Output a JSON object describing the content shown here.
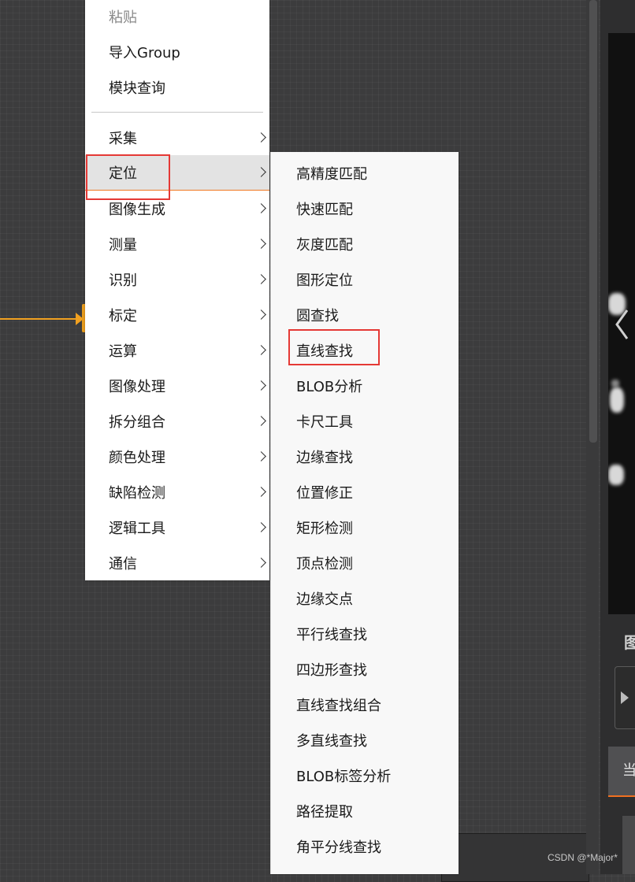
{
  "context_menu": {
    "items_top": [
      {
        "label": "粘贴",
        "disabled": true
      },
      {
        "label": "导入Group"
      },
      {
        "label": "模块查询"
      }
    ],
    "items": [
      {
        "label": "采集"
      },
      {
        "label": "定位",
        "active": true
      },
      {
        "label": "图像生成"
      },
      {
        "label": "测量"
      },
      {
        "label": "识别"
      },
      {
        "label": "标定"
      },
      {
        "label": "运算"
      },
      {
        "label": "图像处理"
      },
      {
        "label": "拆分组合"
      },
      {
        "label": "颜色处理"
      },
      {
        "label": "缺陷检测"
      },
      {
        "label": "逻辑工具"
      },
      {
        "label": "通信"
      }
    ]
  },
  "submenu": {
    "parent": "定位",
    "items": [
      "高精度匹配",
      "快速匹配",
      "灰度匹配",
      "图形定位",
      "圆查找",
      "直线查找",
      "BLOB分析",
      "卡尺工具",
      "边缘查找",
      "位置修正",
      "矩形检测",
      "顶点检测",
      "边缘交点",
      "平行线查找",
      "四边形查找",
      "直线查找组合",
      "多直线查找",
      "BLOB标签分析",
      "路径提取",
      "角平分线查找"
    ],
    "highlighted": "直线查找"
  },
  "right_panel": {
    "label_1": "图",
    "tab_label": "当"
  },
  "watermark": "CSDN @*Major*",
  "colors": {
    "accent": "#f07820",
    "highlight_box": "#e53935",
    "connector": "#f0a020"
  }
}
